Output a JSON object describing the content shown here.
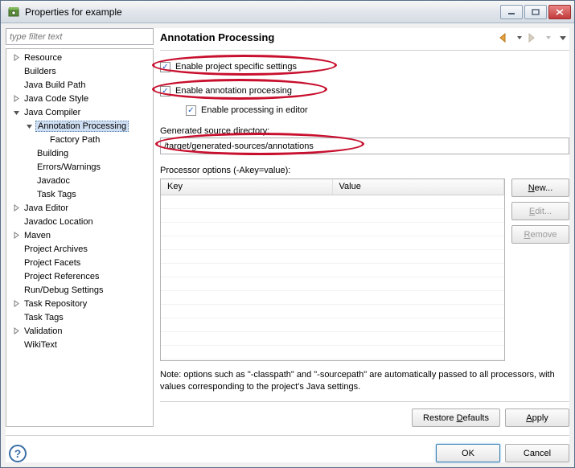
{
  "window": {
    "title": "Properties for example"
  },
  "filter": {
    "placeholder": "type filter text"
  },
  "tree": {
    "items": [
      {
        "label": "Resource",
        "level": 1,
        "exp": "closed"
      },
      {
        "label": "Builders",
        "level": 1,
        "exp": "none"
      },
      {
        "label": "Java Build Path",
        "level": 1,
        "exp": "none"
      },
      {
        "label": "Java Code Style",
        "level": 1,
        "exp": "closed"
      },
      {
        "label": "Java Compiler",
        "level": 1,
        "exp": "open"
      },
      {
        "label": "Annotation Processing",
        "level": 2,
        "exp": "open",
        "sel": true
      },
      {
        "label": "Factory Path",
        "level": 3,
        "exp": "none"
      },
      {
        "label": "Building",
        "level": 2,
        "exp": "none"
      },
      {
        "label": "Errors/Warnings",
        "level": 2,
        "exp": "none"
      },
      {
        "label": "Javadoc",
        "level": 2,
        "exp": "none"
      },
      {
        "label": "Task Tags",
        "level": 2,
        "exp": "none"
      },
      {
        "label": "Java Editor",
        "level": 1,
        "exp": "closed"
      },
      {
        "label": "Javadoc Location",
        "level": 1,
        "exp": "none"
      },
      {
        "label": "Maven",
        "level": 1,
        "exp": "closed"
      },
      {
        "label": "Project Archives",
        "level": 1,
        "exp": "none"
      },
      {
        "label": "Project Facets",
        "level": 1,
        "exp": "none"
      },
      {
        "label": "Project References",
        "level": 1,
        "exp": "none"
      },
      {
        "label": "Run/Debug Settings",
        "level": 1,
        "exp": "none"
      },
      {
        "label": "Task Repository",
        "level": 1,
        "exp": "closed"
      },
      {
        "label": "Task Tags",
        "level": 1,
        "exp": "none"
      },
      {
        "label": "Validation",
        "level": 1,
        "exp": "closed"
      },
      {
        "label": "WikiText",
        "level": 1,
        "exp": "none"
      }
    ]
  },
  "page": {
    "title": "Annotation Processing",
    "checks": {
      "project_specific": "Enable project specific settings",
      "enable_ap": "Enable annotation processing",
      "enable_editor": "Enable processing in editor"
    },
    "gen_dir_label": "Generated source directory:",
    "gen_dir_value": "/target/generated-sources/annotations",
    "proc_opts_label": "Processor options (-Akey=value):",
    "table": {
      "col_key": "Key",
      "col_value": "Value"
    },
    "buttons": {
      "new": "New...",
      "edit": "Edit...",
      "remove": "Remove"
    },
    "note": "Note: options such as \"-classpath\" and \"-sourcepath\" are automatically passed to all processors, with values corresponding to the project's Java settings.",
    "restore": "Restore Defaults",
    "apply": "Apply"
  },
  "dialog": {
    "ok": "OK",
    "cancel": "Cancel"
  },
  "accel": {
    "new": "N",
    "edit": "E",
    "remove": "R",
    "restore": "D",
    "apply": "A"
  }
}
